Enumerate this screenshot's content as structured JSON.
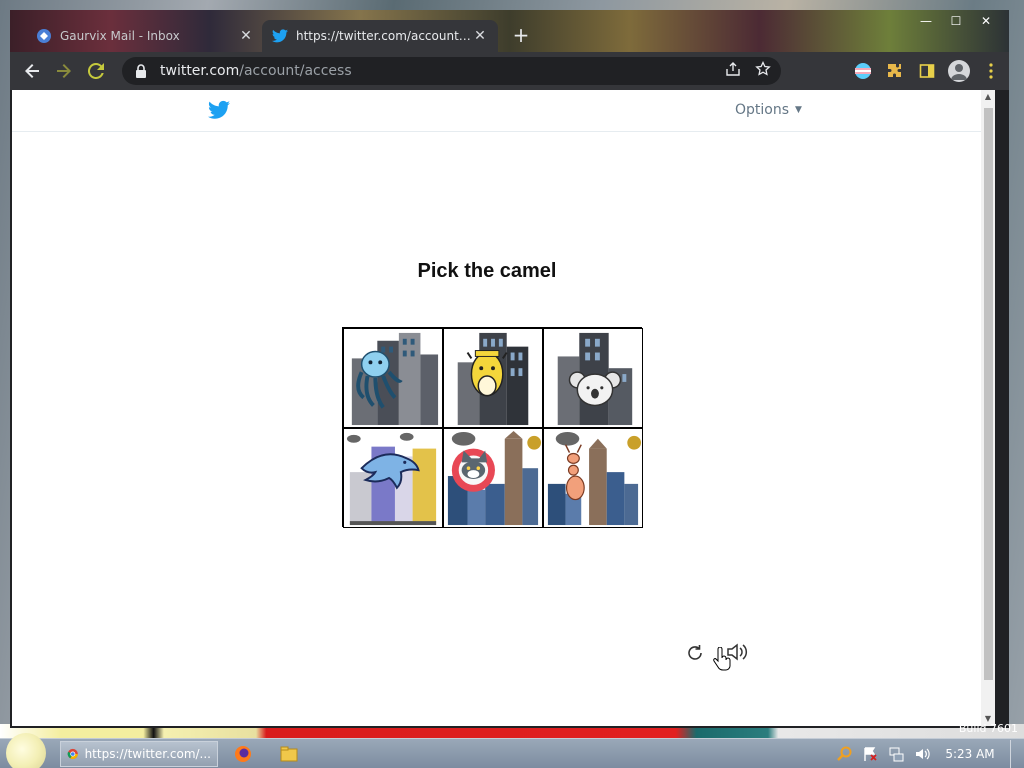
{
  "browser": {
    "tabs": [
      {
        "title": "Gaurvix Mail - Inbox",
        "active": false
      },
      {
        "title": "https://twitter.com/account/access",
        "active": true
      }
    ],
    "new_tab": "+",
    "window_controls": [
      "—",
      "☐",
      "✕"
    ],
    "address": {
      "host": "twitter.com",
      "path": "/account/access"
    }
  },
  "page": {
    "options_label": "Options",
    "challenge_title": "Pick the camel",
    "grid": [
      {
        "animal": "octopus"
      },
      {
        "animal": "camel"
      },
      {
        "animal": "koala"
      },
      {
        "animal": "dolphin"
      },
      {
        "animal": "cat"
      },
      {
        "animal": "ant"
      }
    ]
  },
  "taskbar": {
    "task_label": "https://twitter.com/...",
    "clock": "5:23 AM",
    "build": "Build 7601"
  },
  "colors": {
    "twitter_blue": "#1da1f2",
    "tab_active": "#35363a",
    "toolbar": "#35363a"
  }
}
